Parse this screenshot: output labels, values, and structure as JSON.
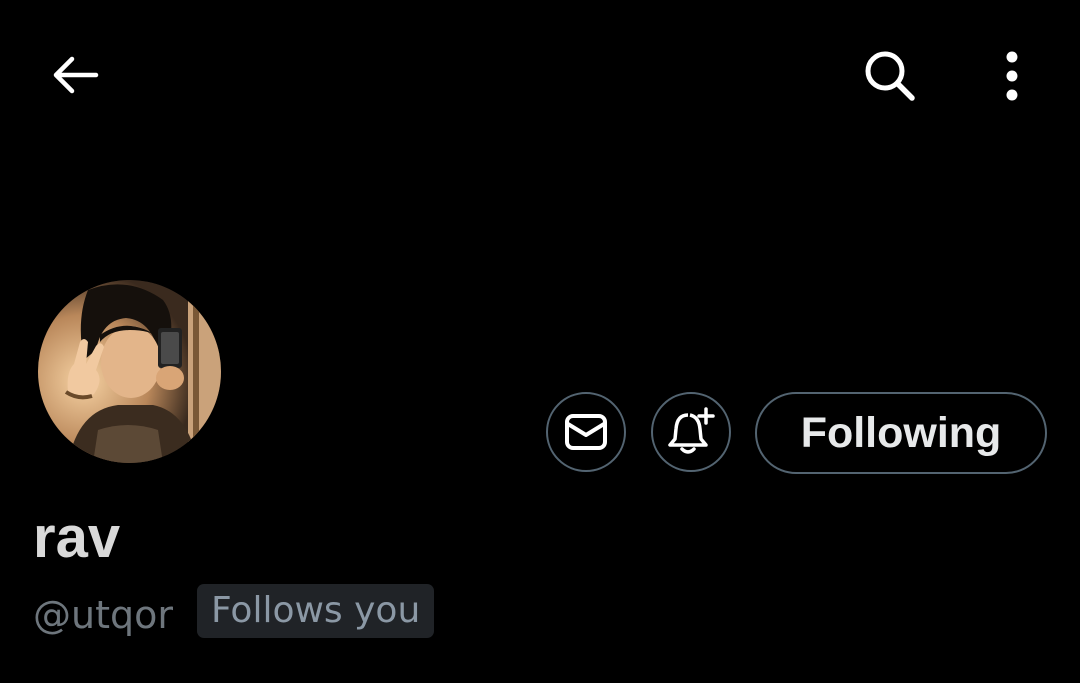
{
  "header": {
    "back_icon": "arrow-left-icon",
    "search_icon": "search-icon",
    "more_icon": "more-vertical-icon"
  },
  "profile": {
    "avatar": "profile-photo",
    "display_name": "rav",
    "handle": "@utqor",
    "follows_you_badge": "Follows you"
  },
  "actions": {
    "message_icon": "envelope-icon",
    "notify_icon": "bell-plus-icon",
    "following_label": "Following"
  },
  "colors": {
    "background": "#000000",
    "text_primary": "#e7e9ea",
    "text_secondary": "#6e767d",
    "border": "#536471",
    "badge_bg": "#202327"
  }
}
